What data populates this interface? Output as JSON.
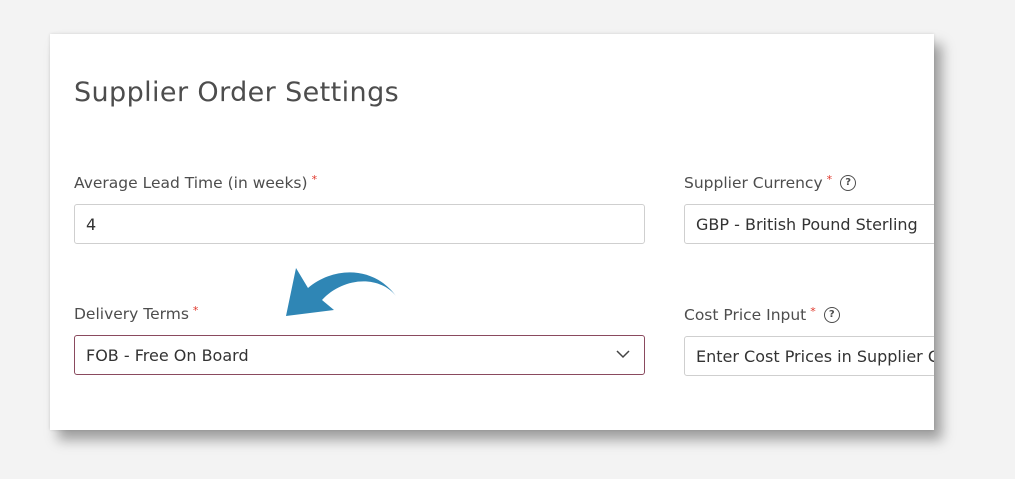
{
  "page": {
    "title": "Supplier Order Settings"
  },
  "form": {
    "lead_time": {
      "label": "Average Lead Time (in weeks)",
      "required_mark": "*",
      "value": "4"
    },
    "supplier_currency": {
      "label": "Supplier Currency",
      "required_mark": "*",
      "help_icon": "?",
      "value": "GBP - British Pound Sterling"
    },
    "delivery_terms": {
      "label": "Delivery Terms",
      "required_mark": "*",
      "value": "FOB - Free On Board"
    },
    "cost_price_input": {
      "label": "Cost Price Input",
      "required_mark": "*",
      "help_icon": "?",
      "value": "Enter Cost Prices in Supplier Currency"
    }
  },
  "icons": {
    "help": "question-circle-icon",
    "dropdown": "chevron-down-icon",
    "annotation": "curved-arrow-icon"
  },
  "colors": {
    "required": "#e0362a",
    "select_border": "#8a4a5e",
    "annotation_arrow": "#2f86b5"
  }
}
